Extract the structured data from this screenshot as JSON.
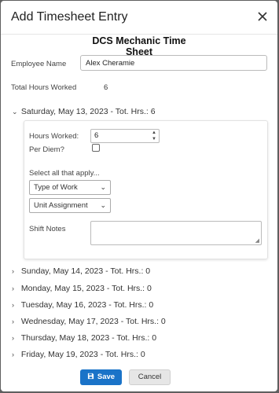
{
  "dialog": {
    "title": "Add Timesheet Entry",
    "sheet_title": "DCS Mechanic Time Sheet"
  },
  "form": {
    "employee_name_label": "Employee Name",
    "employee_name_value": "Alex Cheramie",
    "total_hours_label": "Total Hours Worked",
    "total_hours_value": "6"
  },
  "days": [
    {
      "label": "Saturday, May 13, 2023 - Tot. Hrs.: 6",
      "expanded": true
    },
    {
      "label": "Sunday, May 14, 2023 - Tot. Hrs.: 0",
      "expanded": false
    },
    {
      "label": "Monday, May 15, 2023 - Tot. Hrs.: 0",
      "expanded": false
    },
    {
      "label": "Tuesday, May 16, 2023 - Tot. Hrs.: 0",
      "expanded": false
    },
    {
      "label": "Wednesday, May 17, 2023 - Tot. Hrs.: 0",
      "expanded": false
    },
    {
      "label": "Thursday, May 18, 2023 - Tot. Hrs.: 0",
      "expanded": false
    },
    {
      "label": "Friday, May 19, 2023 - Tot. Hrs.: 0",
      "expanded": false
    }
  ],
  "panel": {
    "hours_label": "Hours Worked:",
    "hours_value": "6",
    "per_diem_label": "Per Diem?",
    "per_diem_checked": false,
    "select_all_label": "Select all that apply...",
    "type_of_work": "Type of Work",
    "unit_assignment": "Unit Assignment",
    "shift_notes_label": "Shift Notes"
  },
  "buttons": {
    "save": "Save",
    "cancel": "Cancel"
  },
  "icons": {
    "close": "close-icon",
    "save": "floppy-disk-icon",
    "expand": "chevron-icon"
  },
  "colors": {
    "primary": "#1a73c8",
    "backdrop": "#5f5f5f"
  }
}
